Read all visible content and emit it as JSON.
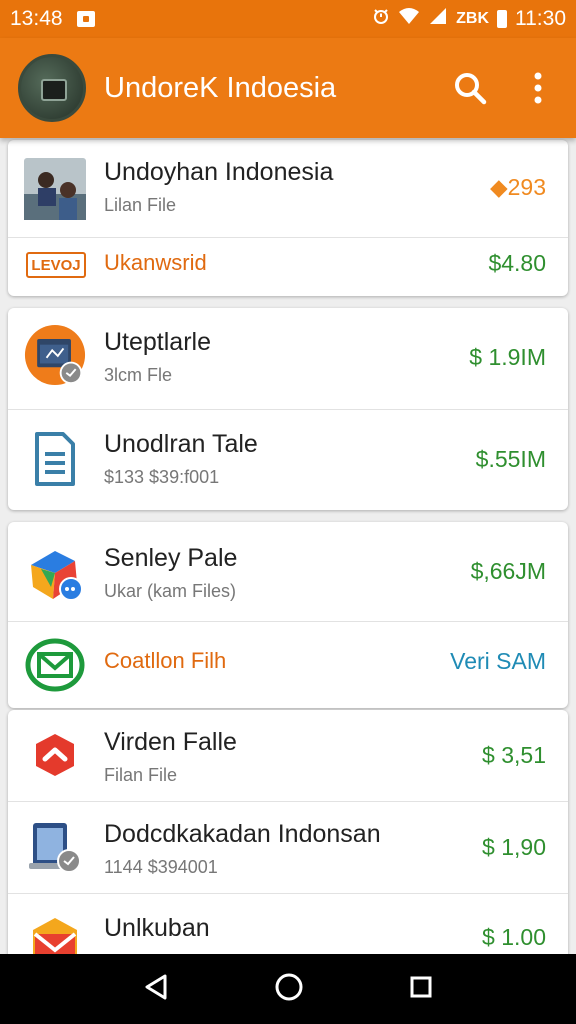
{
  "status_bar": {
    "time_left": "13:48",
    "extra": "ZBK",
    "time_right": "11:30"
  },
  "app_bar": {
    "title": "UndoreK Indoesia",
    "logo_icon": "camera-logo-icon",
    "search_icon": "search-icon",
    "menu_icon": "more-vert-icon"
  },
  "cards": [
    {
      "rows": [
        {
          "title": "Undoyhan Indonesia",
          "subtitle": "Lilan File",
          "price": "◆293",
          "icon": "photo-thumbnail-icon"
        },
        {
          "title": "Ukanwsrid",
          "badge": "LEVOJ",
          "price": "$4.80"
        }
      ]
    },
    {
      "rows": [
        {
          "title": "Uteptlarle",
          "subtitle": "3lcm Fle",
          "price": "$ 1.9IM",
          "icon": "window-app-icon"
        },
        {
          "title": "Unodlran Tale",
          "subtitle": "$133 $39:f001",
          "price": "$.55IM",
          "icon": "document-icon"
        }
      ]
    },
    {
      "rows": [
        {
          "title": "Senley Pale",
          "subtitle": "Ukar (kam Files)",
          "price": "$,66JM",
          "icon": "colorful-cube-icon"
        },
        {
          "title": "Coatllon Filh",
          "price": "Veri SAM",
          "icon": "mail-icon"
        }
      ]
    },
    {
      "rows": [
        {
          "title": "Virden Falle",
          "subtitle": "Filan File",
          "price": "$ 3,51",
          "icon": "red-hexagon-icon"
        },
        {
          "title": "Dodcdkakadan Indonsan",
          "subtitle": "1144 $394001",
          "price": "$ 1,90",
          "icon": "tablet-icon"
        },
        {
          "title": "Unlkuban",
          "price": "$ 1.00",
          "icon": "gmail-icon"
        }
      ]
    }
  ],
  "nav_bar": {
    "back_icon": "back-triangle-icon",
    "home_icon": "home-circle-icon",
    "recents_icon": "recents-square-icon"
  }
}
